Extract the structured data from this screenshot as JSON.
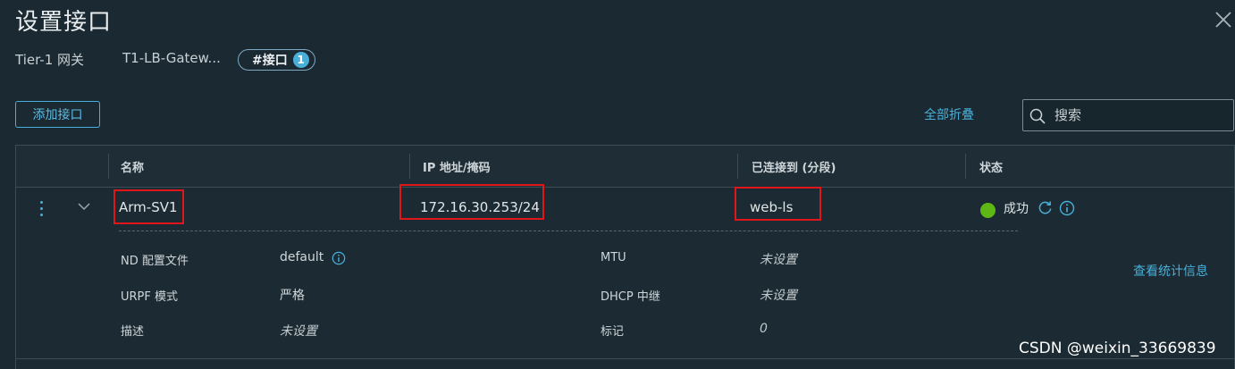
{
  "dialog": {
    "title": "设置接口"
  },
  "breadcrumb": {
    "item1": "Tier-1 网关",
    "item2": "T1-LB-Gatew...",
    "pill_label": "#接口",
    "pill_count": "1"
  },
  "toolbar": {
    "add_label": "添加接口",
    "collapse_all": "全部折叠",
    "search_placeholder": "搜索"
  },
  "table": {
    "columns": [
      "名称",
      "IP 地址/掩码",
      "已连接到 (分段)",
      "状态"
    ],
    "row": {
      "name": "Arm-SV1",
      "ip": "172.16.30.253/24",
      "segment": "web-ls",
      "status": "成功"
    },
    "details": {
      "nd_label": "ND 配置文件",
      "nd_value": "default",
      "urpf_label": "URPF 模式",
      "urpf_value": "严格",
      "desc_label": "描述",
      "desc_value": "未设置",
      "mtu_label": "MTU",
      "mtu_value": "未设置",
      "dhcp_label": "DHCP 中继",
      "dhcp_value": "未设置",
      "tag_label": "标记",
      "tag_value": "0",
      "stats_link": "查看统计信息"
    }
  },
  "watermark": "CSDN @weixin_33669839",
  "colors": {
    "accent": "#49afd9",
    "success": "#5eb715",
    "highlight": "#e0161b",
    "background": "#1b2a32"
  },
  "icons": [
    "close-icon",
    "search-icon",
    "kebab-menu-icon",
    "chevron-down-icon",
    "success-dot-icon",
    "refresh-icon",
    "info-icon"
  ]
}
